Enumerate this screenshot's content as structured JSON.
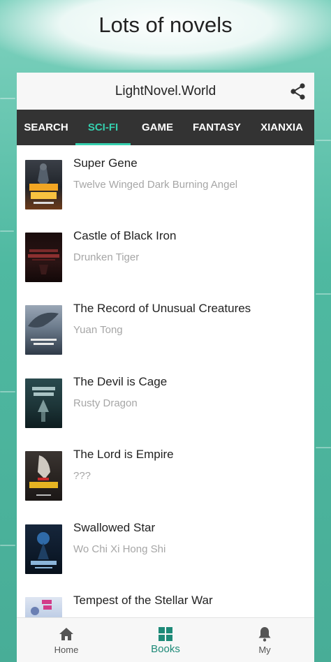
{
  "banner": {
    "title": "Lots of novels"
  },
  "app": {
    "title": "LightNovel.World"
  },
  "icons": {
    "share": "share-icon",
    "home": "home-icon",
    "books": "grid-icon",
    "my": "bell-icon"
  },
  "colors": {
    "accent": "#35cfae",
    "tab_bar": "#333333",
    "nav_active": "#1e8a78",
    "background": "#4fb9a1"
  },
  "tabs": [
    {
      "label": "SEARCH",
      "active": false
    },
    {
      "label": "SCI-FI",
      "active": true
    },
    {
      "label": "GAME",
      "active": false
    },
    {
      "label": "FANTASY",
      "active": false
    },
    {
      "label": "XIANXIA",
      "active": false
    }
  ],
  "books": [
    {
      "title": "Super Gene",
      "author": "Twelve Winged Dark Burning Angel",
      "cover_text": "超级神基因"
    },
    {
      "title": "Castle of Black Iron",
      "author": "Drunken Tiger",
      "cover_text": "CASTLE OF BLACK IRON"
    },
    {
      "title": "The Record of Unusual Creatures",
      "author": "Yuan Tong",
      "cover_text": "The Record of Unusual Creatures"
    },
    {
      "title": "The Devil is Cage",
      "author": "Rusty Dragon",
      "cover_text": "DEVIL'S CAGE"
    },
    {
      "title": "The Lord is Empire",
      "author": "???",
      "cover_text": "兵伐天下"
    },
    {
      "title": "Swallowed Star",
      "author": "Wo Chi Xi Hong Shi",
      "cover_text": "吞噬星空"
    },
    {
      "title": "Tempest of the Stellar War",
      "author": "",
      "cover_text": "星战"
    }
  ],
  "nav": [
    {
      "label": "Home",
      "active": false
    },
    {
      "label": "Books",
      "active": true
    },
    {
      "label": "My",
      "active": false
    }
  ]
}
